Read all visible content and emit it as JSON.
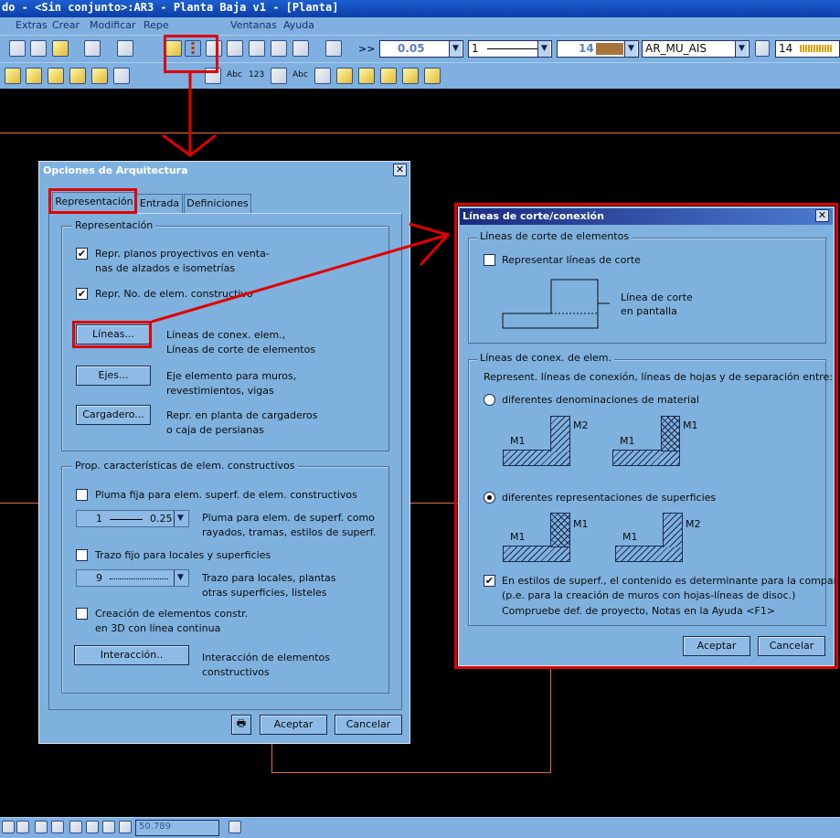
{
  "window": {
    "title": "do - <Sin conjunto>:AR3 - Planta Baja v1 - [Planta]"
  },
  "menu": [
    "Extras",
    "Crear",
    "Modificar",
    "Repe",
    "Ventanas",
    "Ayuda"
  ],
  "toolbar": {
    "pen_value": "0.05",
    "line_value": "1",
    "color_value": "14",
    "layer_value": "AR_MU_AIS",
    "count_value": "14",
    "overflow_label": ">>",
    "tb2_labels": [
      "Abc",
      "123",
      "Abc"
    ]
  },
  "colors": {
    "accent_red": "#e00000",
    "dialog_bg": "#7fb1de",
    "canvas_line": "#e07040",
    "title_blue": "#0b3ea8",
    "material_swatch": "#a6733b"
  },
  "dialog1": {
    "title": "Opciones de Arquitectura",
    "tabs": [
      "Representación",
      "Entrada",
      "Definiciones"
    ],
    "group1": {
      "label": "Representación",
      "check1": {
        "label_line1": "Repr. planos proyectivos en venta-",
        "label_line2": "nas de alzados e isometrías",
        "checked": true
      },
      "check2": {
        "label": "Repr. No. de elem. constructivo",
        "checked": true
      },
      "btn_lineas": "Líneas...",
      "lineas_desc1": "Líneas de conex. elem.,",
      "lineas_desc2": "Líneas de corte de elementos",
      "btn_ejes": "Ejes...",
      "ejes_desc1": "Eje elemento para muros,",
      "ejes_desc2": "revestimientos, vigas",
      "btn_cargadero": "Cargadero...",
      "cargadero_desc1": "Repr. en planta de cargaderos",
      "cargadero_desc2": "o caja de persianas"
    },
    "group2": {
      "label": "Prop. características de elem. constructivos",
      "check3": {
        "label": "Pluma fija para elem. superf. de elem. constructivos",
        "checked": false
      },
      "pen_combo": {
        "left": "1",
        "right": "0.25"
      },
      "pen_desc1": "Pluma para elem. de superf. como",
      "pen_desc2": "rayados, tramas, estilos de superf.",
      "check4": {
        "label": "Trazo fijo para locales y superficies",
        "checked": false
      },
      "trazo_combo": {
        "left": "9"
      },
      "trazo_desc1": "Trazo para locales, plantas",
      "trazo_desc2": "otras superficies, listeles",
      "check5": {
        "label_line1": "Creación de elementos constr.",
        "label_line2": "en 3D con línea continua",
        "checked": false
      },
      "btn_interaccion": "Interacción..",
      "interaccion_desc1": "Interacción de elementos",
      "interaccion_desc2": "constructivos"
    },
    "btn_ok": "Aceptar",
    "btn_cancel": "Cancelar"
  },
  "dialog2": {
    "title": "Líneas de corte/conexión",
    "group1": {
      "label": "Líneas de corte de elementos",
      "check": {
        "label": "Representar líneas de corte",
        "checked": false
      },
      "diagram_label1": "Línea de corte",
      "diagram_label2": "en pantalla"
    },
    "group2": {
      "label": "Líneas de conex. de elem.",
      "intro": "Represent. líneas de conexión, líneas de hojas y de separación entre:",
      "radio1": {
        "label": "diferentes denominaciones de material",
        "selected": false
      },
      "radio2": {
        "label": "diferentes representaciones de superficies",
        "selected": true
      },
      "m1": "M1",
      "m2": "M2",
      "check": {
        "line1": "En estilos de superf.,  el contenido es determinante para la comparación",
        "line2": "(p.e. para la creación de muros con hojas-líneas de disoc.)",
        "line3": "Compruebe def. de proyecto, Notas en la Ayuda <F1>",
        "checked": true
      }
    },
    "btn_ok": "Aceptar",
    "btn_cancel": "Cancelar"
  },
  "statusbar": {
    "coordinate": "50.789"
  }
}
